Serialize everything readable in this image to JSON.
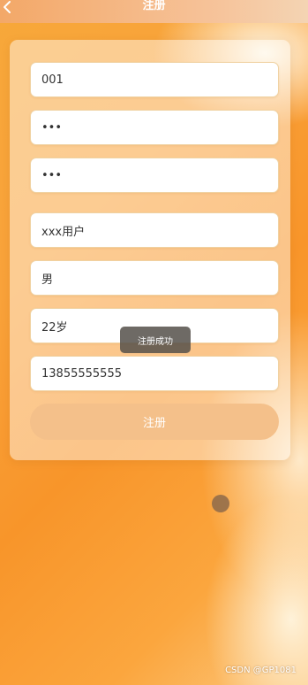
{
  "header": {
    "title": "注册"
  },
  "form": {
    "fields": [
      {
        "name": "username",
        "value": "001"
      },
      {
        "name": "password",
        "value": "•••"
      },
      {
        "name": "confirm_password",
        "value": "•••"
      },
      {
        "name": "nickname",
        "value": "xxx用户"
      },
      {
        "name": "gender",
        "value": "男"
      },
      {
        "name": "age",
        "value": "22岁"
      },
      {
        "name": "phone",
        "value": "13855555555"
      }
    ],
    "submit_label": "注册"
  },
  "toast": {
    "message": "注册成功"
  },
  "watermark": {
    "text": "CSDN @GP1081"
  },
  "colors": {
    "accent": "#f8952a",
    "button": "#f4c08a",
    "toast_bg": "#55504a"
  }
}
